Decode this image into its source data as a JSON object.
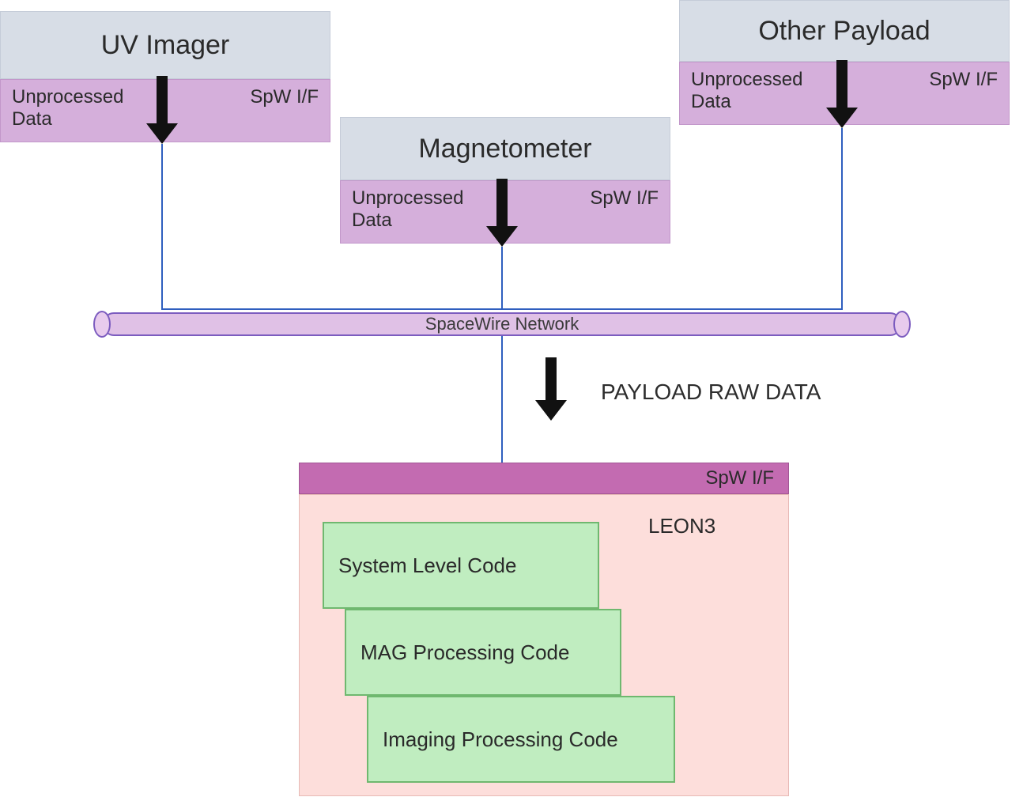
{
  "payloads": {
    "uv": {
      "title": "UV Imager",
      "unprocessed_line1": "Unprocessed",
      "unprocessed_line2": "Data",
      "spw": "SpW I/F"
    },
    "mag": {
      "title": "Magnetometer",
      "unprocessed_line1": "Unprocessed",
      "unprocessed_line2": "Data",
      "spw": "SpW I/F"
    },
    "other": {
      "title": "Other Payload",
      "unprocessed_line1": "Unprocessed",
      "unprocessed_line2": "Data",
      "spw": "SpW I/F"
    }
  },
  "network": {
    "label": "SpaceWire Network"
  },
  "raw_label": "PAYLOAD RAW DATA",
  "processor": {
    "spw": "SpW I/F",
    "name": "LEON3",
    "cards": {
      "c0": "System Level Code",
      "c1": "MAG Processing Code",
      "c2": "Imaging Processing Code"
    }
  }
}
